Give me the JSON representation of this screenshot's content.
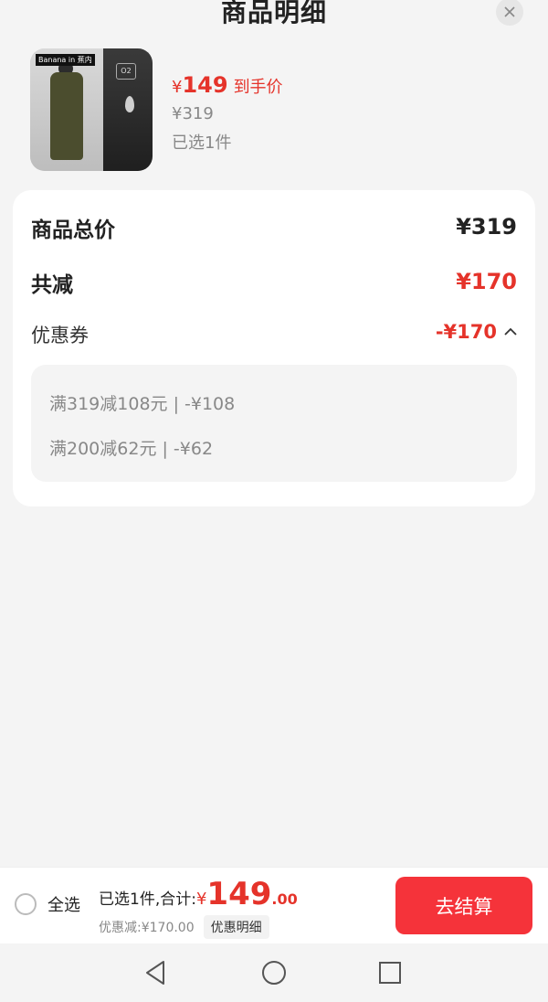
{
  "header": {
    "title": "商品明细"
  },
  "product": {
    "thumb_brand": "Banana in 蕉内",
    "thumb_badge": "O2",
    "yen_symbol": "¥",
    "price": "149",
    "price_tag": "到手价",
    "original_price": "¥319",
    "selected": "已选1件"
  },
  "summary": {
    "total_label": "商品总价",
    "total_value": "¥319",
    "reduce_label": "共减",
    "reduce_value": "¥170",
    "coupon_label": "优惠券",
    "coupon_value": "-¥170",
    "coupon_items": [
      "满319减108元 | -¥108",
      "满200减62元 | -¥62"
    ]
  },
  "bottom_bar": {
    "select_all": "全选",
    "total_prefix": "已选1件,合计:",
    "yen": "¥",
    "total_int": "149",
    "total_dec": ".00",
    "discount_text": "优惠减:¥170.00",
    "discount_detail": "优惠明细",
    "checkout": "去结算"
  },
  "colors": {
    "accent": "#e5332a",
    "checkout_bg": "#f5333a",
    "page_bg": "#f4f4f4"
  },
  "icons": [
    "close-icon",
    "chevron-up-icon",
    "radio-icon",
    "nav-back-icon",
    "nav-home-icon",
    "nav-recents-icon"
  ]
}
